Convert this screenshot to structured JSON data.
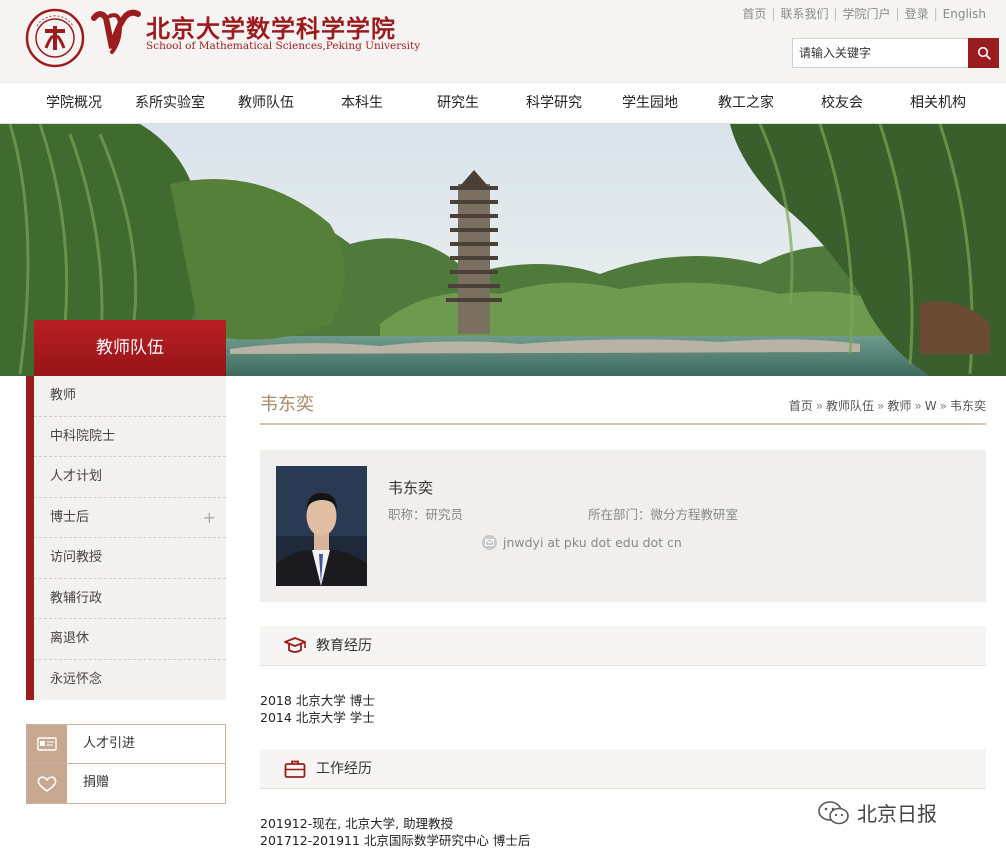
{
  "header": {
    "logo_cn": "北京大学数学科学学院",
    "logo_en": "School of Mathematical Sciences,Peking University",
    "seal_text": "PEKING UNIVERSITY 1898",
    "top_links": [
      "首页",
      "联系我们",
      "学院门户",
      "登录",
      "English"
    ],
    "search_placeholder": "请输入关键字"
  },
  "nav": {
    "items": [
      "学院概况",
      "系所实验室",
      "教师队伍",
      "本科生",
      "研究生",
      "科学研究",
      "学生园地",
      "教工之家",
      "校友会",
      "相关机构"
    ]
  },
  "sidebar": {
    "title": "教师队伍",
    "items": [
      {
        "label": "教师",
        "expandable": false
      },
      {
        "label": "中科院院士",
        "expandable": false
      },
      {
        "label": "人才计划",
        "expandable": false
      },
      {
        "label": "博士后",
        "expandable": true
      },
      {
        "label": "访问教授",
        "expandable": false
      },
      {
        "label": "教辅行政",
        "expandable": false
      },
      {
        "label": "离退休",
        "expandable": false
      },
      {
        "label": "永远怀念",
        "expandable": false
      }
    ],
    "links": [
      {
        "label": "人才引进",
        "icon": "id-card-icon"
      },
      {
        "label": "捐赠",
        "icon": "heart-hands-icon"
      }
    ]
  },
  "main": {
    "page_title": "韦东奕",
    "breadcrumb": [
      "首页",
      "教师队伍",
      "教师",
      "W",
      "韦东奕"
    ],
    "profile": {
      "name": "韦东奕",
      "title_label": "职称：研究员",
      "dept_label": "所在部门：微分方程教研室",
      "email": "jnwdyi at pku dot edu dot cn"
    },
    "sections": [
      {
        "heading": "教育经历",
        "icon": "graduation-cap-icon",
        "lines": [
          "2018 北京大学 博士",
          "2014 北京大学 学士"
        ]
      },
      {
        "heading": "工作经历",
        "icon": "briefcase-icon",
        "lines": [
          "201912-现在, 北京大学, 助理教授",
          "201712-201911 北京国际数学研究中心 博士后"
        ]
      }
    ]
  },
  "watermark": "北京日报",
  "colors": {
    "brand": "#9b1c1f",
    "accent": "#a88a6d"
  }
}
